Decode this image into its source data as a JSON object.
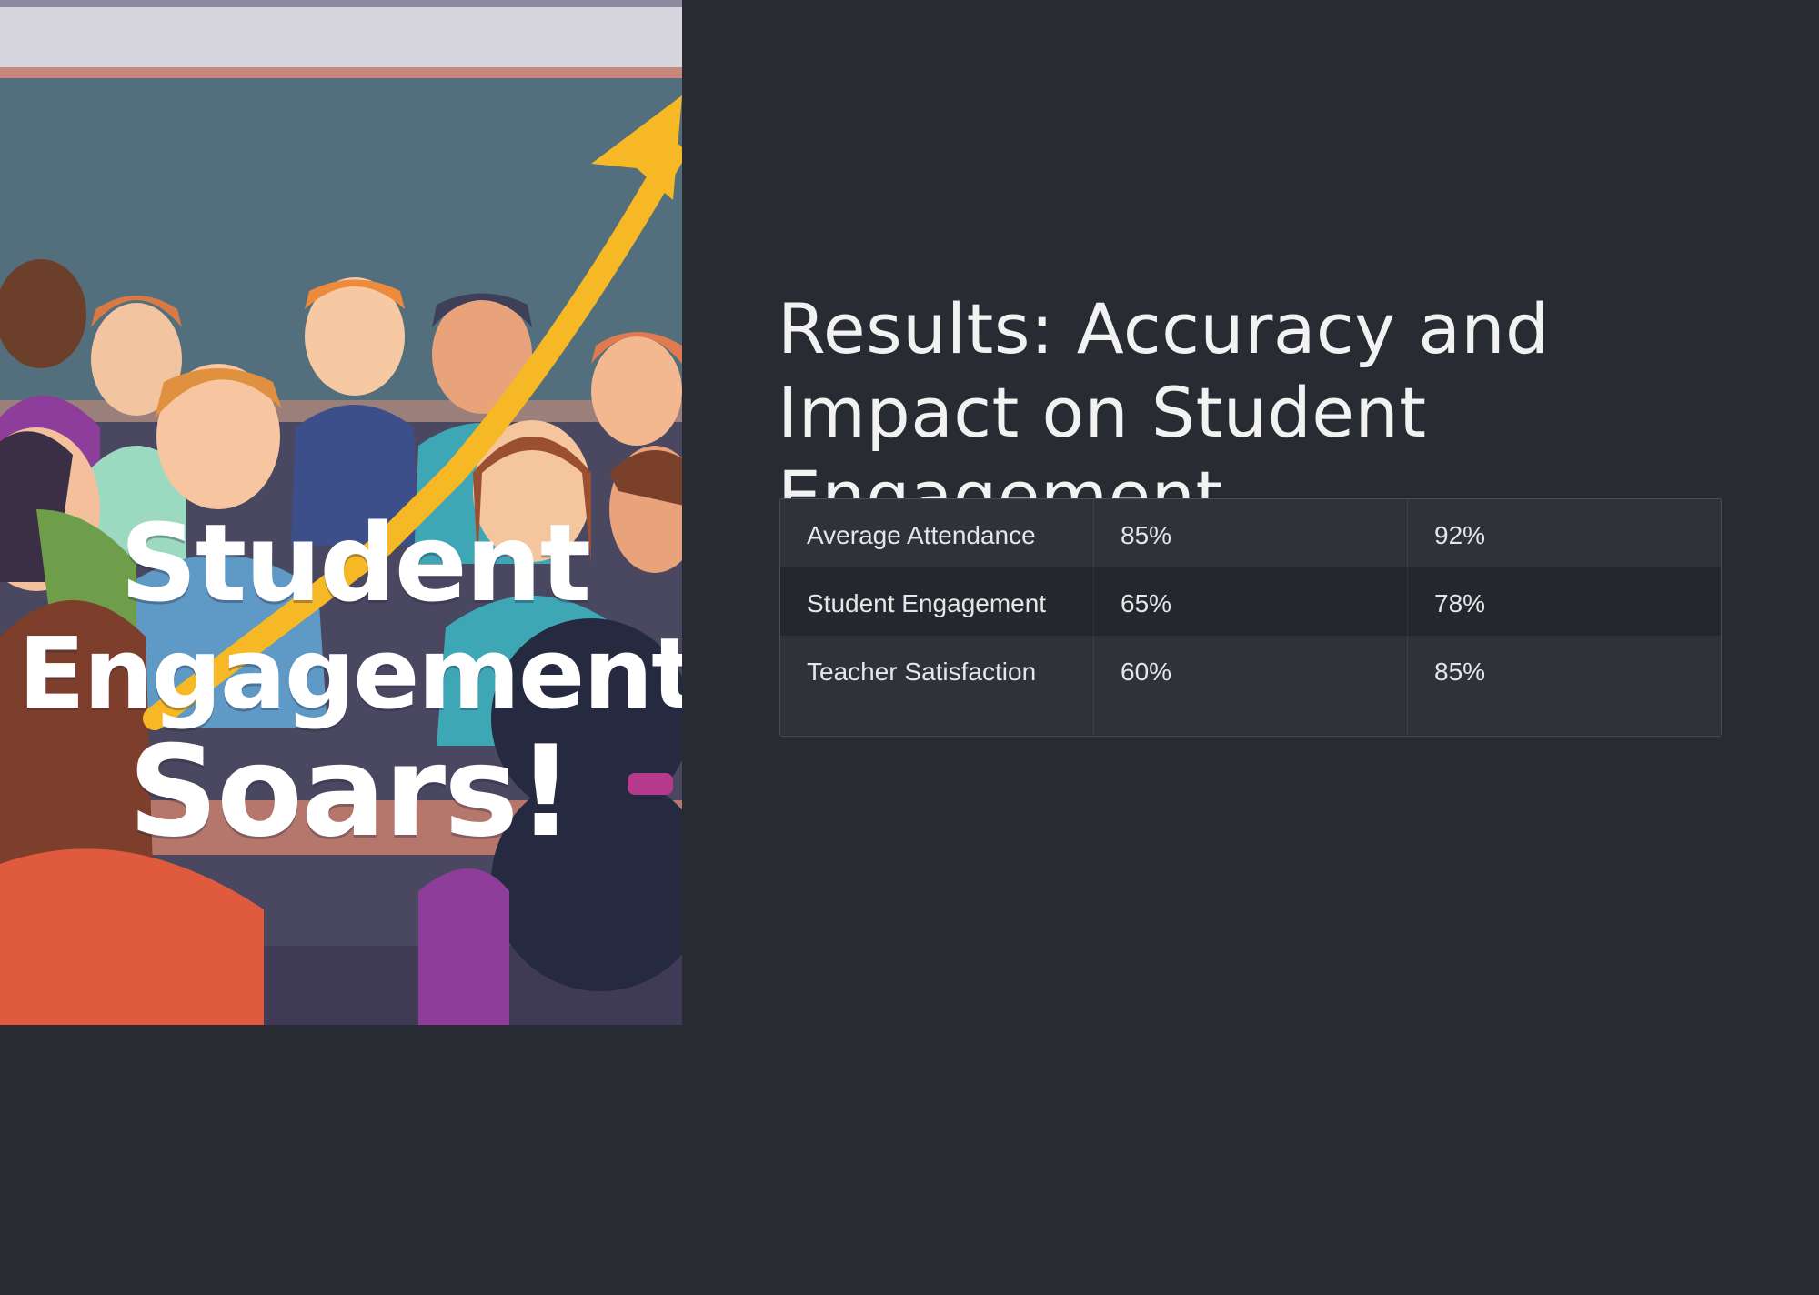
{
  "slide": {
    "title": "Results: Accuracy and Impact on Student Engagement"
  },
  "illustration": {
    "caption_lines": [
      "Student",
      "Engagement",
      "Soars!"
    ]
  },
  "table": {
    "rows": [
      [
        "Average Attendance",
        "85%",
        "92%"
      ],
      [
        "Student Engagement",
        "65%",
        "78%"
      ],
      [
        "Teacher Satisfaction",
        "60%",
        "85%"
      ]
    ]
  },
  "colors": {
    "background": "#292b33",
    "title_text": "#f2f2f2",
    "arrow": "#f6b824",
    "chalkboard": "#4f6a78"
  }
}
